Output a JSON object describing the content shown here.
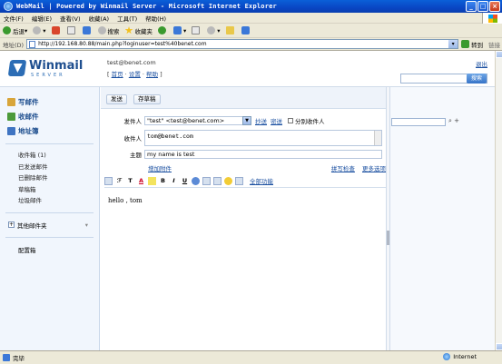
{
  "window": {
    "title": "WebMail | Powered by Winmail Server - Microsoft Internet Explorer"
  },
  "menubar": [
    "文件(F)",
    "编辑(E)",
    "查看(V)",
    "收藏(A)",
    "工具(T)",
    "帮助(H)"
  ],
  "toolbar": {
    "back": "后退",
    "search": "搜索",
    "favorites": "收藏夹"
  },
  "address": {
    "label": "地址(D)",
    "url": "http://192.168.80.88/main.php?loginuser=test%40benet.com",
    "go": "转到",
    "links": "链接"
  },
  "header": {
    "logo_name": "Winmail",
    "logo_sub": "SERVER",
    "user_email": "test@benet.com",
    "link_home": "首页",
    "link_settings": "设置",
    "link_help": "帮助",
    "logout": "退出",
    "search_btn": "搜索"
  },
  "sidebar": {
    "compose": "写邮件",
    "receive": "收邮件",
    "addressbook": "地址簿",
    "folders": [
      "收件箱 (1)",
      "已发送邮件",
      "已删除邮件",
      "草稿箱",
      "垃圾邮件"
    ],
    "other_folders": "其他邮件夹",
    "config": "配置箱"
  },
  "compose": {
    "send": "发送",
    "save_draft": "存草稿",
    "from_label": "发件人",
    "from_value": "\"test\" <test@benet.com>",
    "cc": "抄送",
    "bcc": "密送",
    "separate": "分别收件人",
    "to_label": "收件人",
    "to_value": "tom@benet.com",
    "subject_label": "主题",
    "subject_value": "my name is test",
    "add_attachment": "增加附件",
    "spell_check": "拼写检查",
    "more_options": "更多选项",
    "full_features": "全部功能",
    "body": "hello , tom"
  },
  "status": {
    "done": "完毕",
    "zone": "Internet"
  }
}
